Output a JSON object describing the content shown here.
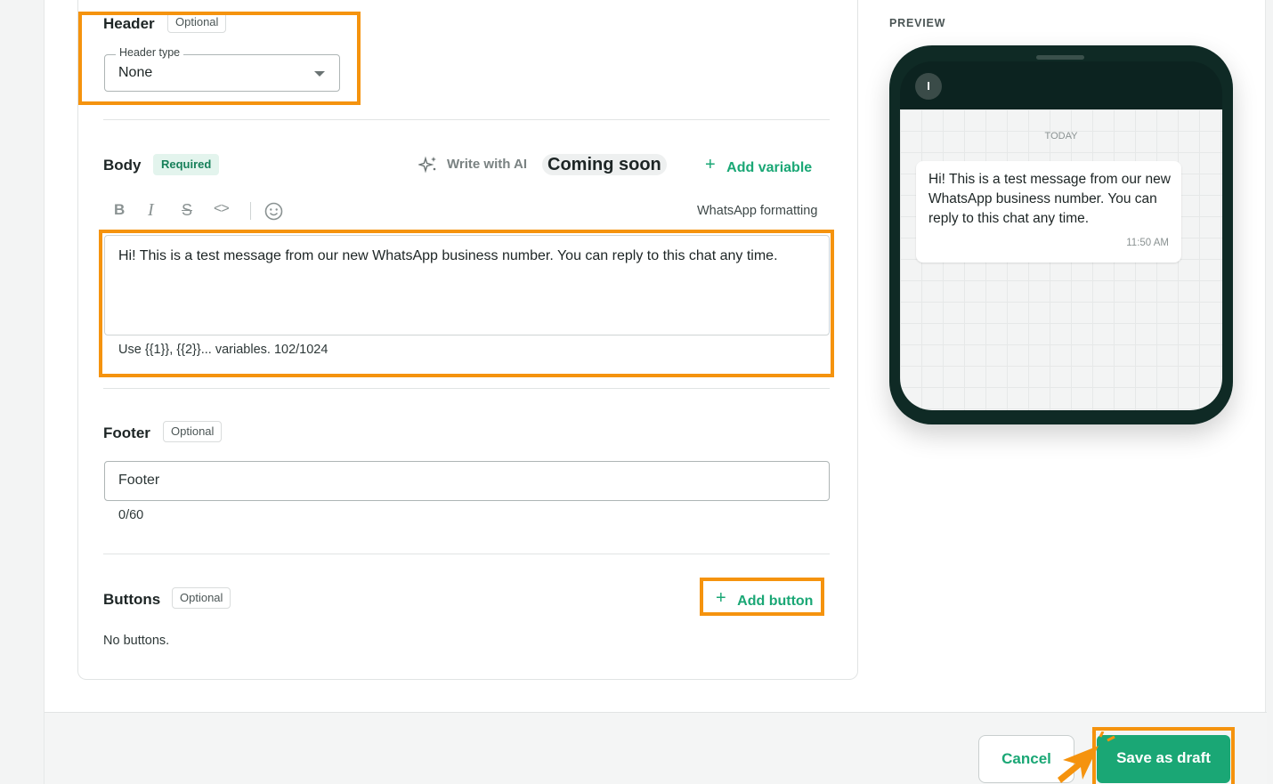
{
  "header": {
    "title": "Header",
    "tag": "Optional",
    "field_label": "Header type",
    "selected_value": "None"
  },
  "body": {
    "title": "Body",
    "tag": "Required",
    "write_ai_label": "Write with AI",
    "coming_soon": "Coming soon",
    "add_variable_label": "Add variable",
    "formatting_link": "WhatsApp formatting",
    "text": "Hi! This is a test message from our new WhatsApp business number. You can reply to this chat any time.",
    "helper": "Use {{1}}, {{2}}... variables. 102/1024"
  },
  "footer": {
    "title": "Footer",
    "tag": "Optional",
    "placeholder": "Footer",
    "counter": "0/60"
  },
  "buttons": {
    "title": "Buttons",
    "tag": "Optional",
    "add_label": "Add button",
    "empty_text": "No buttons."
  },
  "preview": {
    "label": "PREVIEW",
    "avatar_letter": "I",
    "day_label": "TODAY",
    "message": "Hi! This is a test message from our new WhatsApp business number. You can reply to this chat any time.",
    "time": "11:50 AM"
  },
  "actions": {
    "cancel_label": "Cancel",
    "save_label": "Save as draft"
  },
  "colors": {
    "accent": "#1aa775",
    "highlight": "#f5930e",
    "phone_frame": "#0f2a25"
  }
}
